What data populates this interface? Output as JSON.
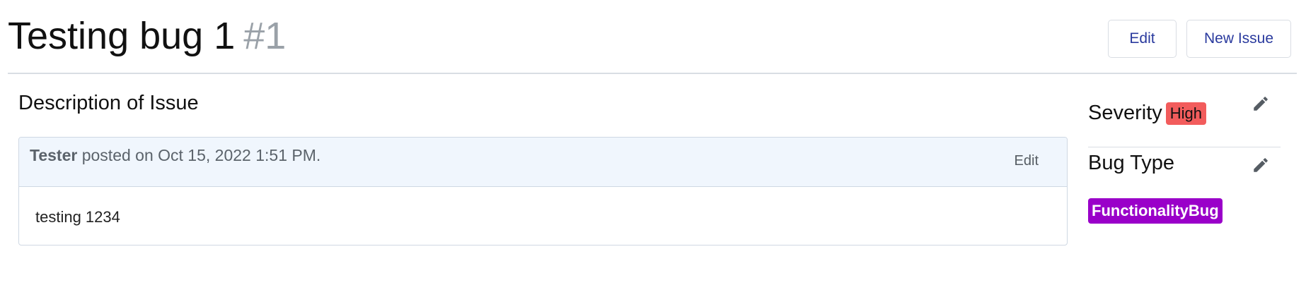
{
  "header": {
    "title": "Testing bug 1",
    "issue_number": "#1",
    "edit_label": "Edit",
    "new_issue_label": "New Issue"
  },
  "description": {
    "heading": "Description of Issue",
    "comment": {
      "author": "Tester",
      "posted_text": "posted on Oct 15, 2022 1:51 PM.",
      "edit_label": "Edit",
      "body": "testing 1234"
    }
  },
  "sidebar": {
    "severity_label": "Severity",
    "severity_value": "High",
    "severity_color": "#f25c5c",
    "bug_type_label": "Bug Type",
    "bug_type_value": "FunctionalityBug",
    "bug_type_color": "#9a00c9",
    "edit_icon": "pencil-icon"
  }
}
